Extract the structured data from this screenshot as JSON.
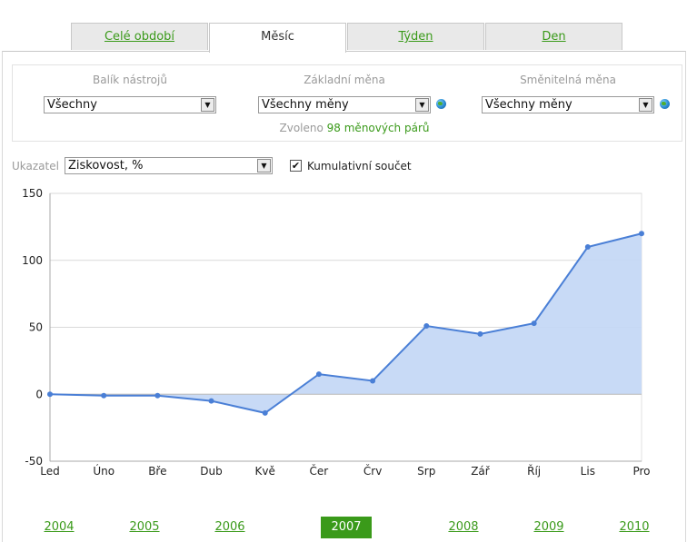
{
  "tabs": [
    {
      "label": "Celé období",
      "active": false
    },
    {
      "label": "Měsíc",
      "active": true
    },
    {
      "label": "Týden",
      "active": false
    },
    {
      "label": "Den",
      "active": false
    }
  ],
  "filters": {
    "toolkit": {
      "label": "Balík nástrojů",
      "value": "Všechny"
    },
    "base_currency": {
      "label": "Základní měna",
      "value": "Všechny měny"
    },
    "quote_currency": {
      "label": "Směnitelná měna",
      "value": "Všechny měny"
    },
    "selected_prefix": "Zvoleno",
    "selected_count": "98 měnových párů"
  },
  "indicator": {
    "label": "Ukazatel",
    "value": "Ziskovost, %",
    "cumulative_label": "Kumulativní součet",
    "cumulative_checked": true,
    "check_mark": "✔"
  },
  "chart_data": {
    "type": "area",
    "categories": [
      "Led",
      "Úno",
      "Bře",
      "Dub",
      "Kvě",
      "Čer",
      "Črv",
      "Srp",
      "Zář",
      "Říj",
      "Lis",
      "Pro"
    ],
    "series": [
      {
        "values": [
          0,
          -1,
          -1,
          -5,
          -14,
          15,
          10,
          51,
          45,
          53,
          110,
          120
        ]
      }
    ],
    "ylim": [
      -50,
      150
    ],
    "yticks": [
      -50,
      0,
      50,
      100,
      150
    ],
    "grid": true,
    "colors": {
      "line": "#4a7fd6",
      "fill": "#c5d8f5",
      "grid": "#d9d9d9",
      "axis": "#a9a9a9"
    }
  },
  "years": [
    {
      "label": "2004",
      "active": false
    },
    {
      "label": "2005",
      "active": false
    },
    {
      "label": "2006",
      "active": false
    },
    {
      "label": "2007",
      "active": true
    },
    {
      "label": "2008",
      "active": false
    },
    {
      "label": "2009",
      "active": false
    },
    {
      "label": "2010",
      "active": false
    }
  ]
}
